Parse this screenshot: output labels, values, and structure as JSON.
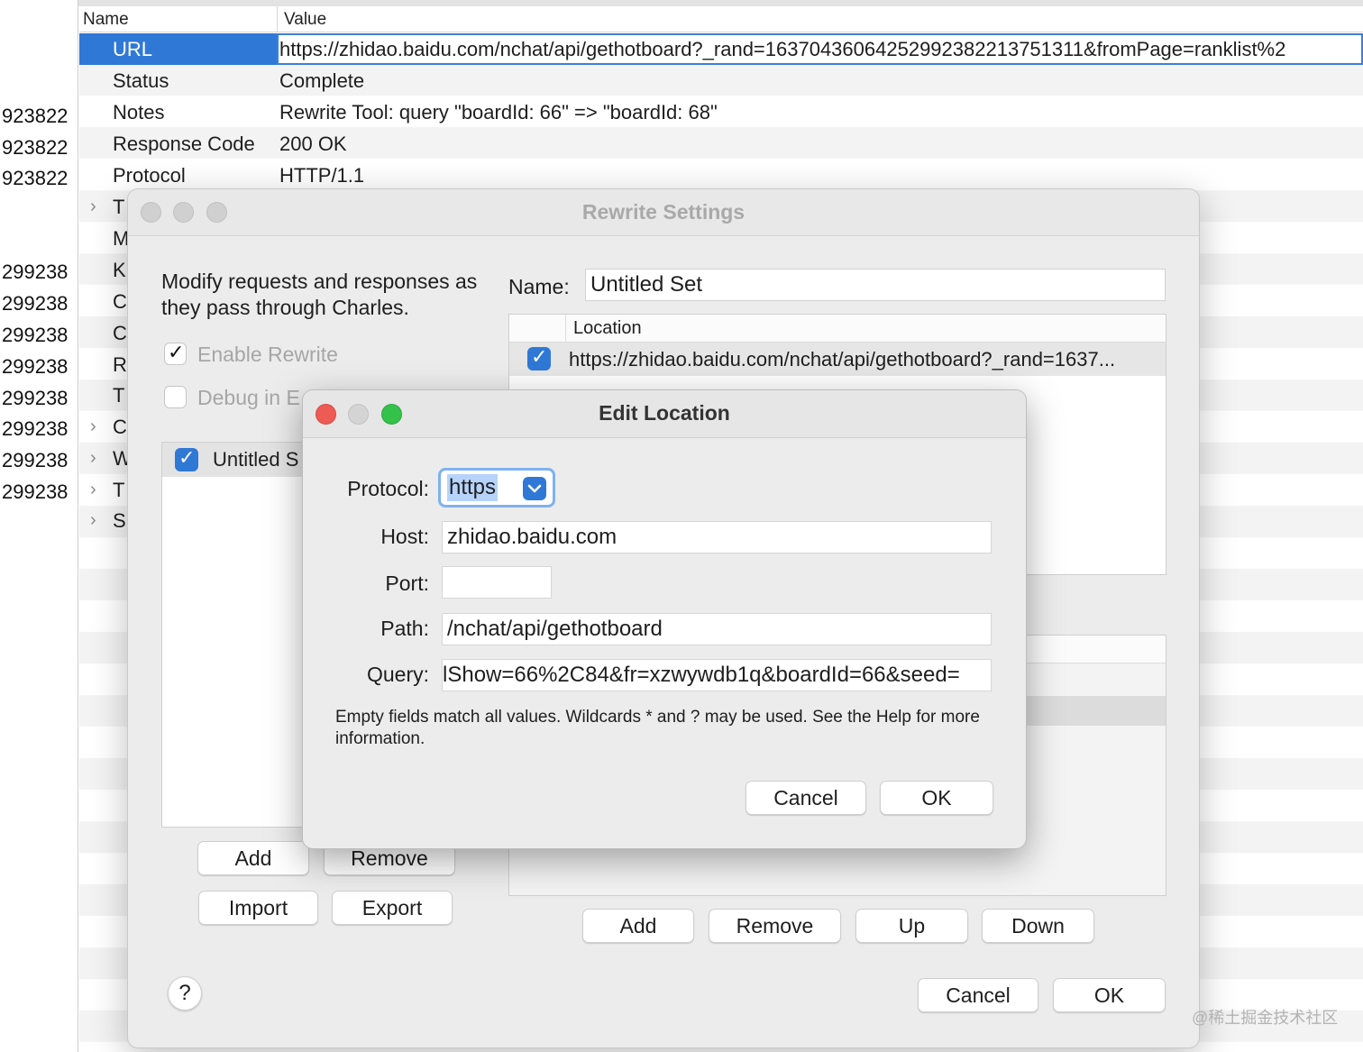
{
  "background": {
    "left_column_numbers": [
      "923822",
      "923822",
      "923822",
      "299238",
      "299238",
      "299238",
      "299238",
      "299238",
      "299238",
      "299238",
      "299238"
    ],
    "table": {
      "headers": {
        "name": "Name",
        "value": "Value"
      },
      "rows": [
        {
          "name": "URL",
          "value": "https://zhidao.baidu.com/nchat/api/gethotboard?_rand=16370436064252992382213751311&fromPage=ranklist%2"
        },
        {
          "name": "Status",
          "value": "Complete"
        },
        {
          "name": "Notes",
          "value": "Rewrite Tool: query \"boardId: 66\" => \"boardId: 68\""
        },
        {
          "name": "Response Code",
          "value": "200 OK"
        },
        {
          "name": "Protocol",
          "value": "HTTP/1.1"
        }
      ],
      "tree_items": [
        "T",
        "M",
        "K",
        "C",
        "C",
        "R",
        "T",
        "C",
        "W",
        "T",
        "S"
      ]
    }
  },
  "rewrite_settings": {
    "title": "Rewrite Settings",
    "description": "Modify requests and responses as they pass through Charles.",
    "enable_rewrite_label": "Enable Rewrite",
    "debug_label": "Debug in E",
    "sets": [
      {
        "label": "Untitled S",
        "checked": true
      }
    ],
    "name_label": "Name:",
    "name_value": "Untitled Set",
    "location_header": "Location",
    "locations": [
      {
        "value": "https://zhidao.baidu.com/nchat/api/gethotboard?_rand=1637...",
        "checked": true
      }
    ],
    "buttons": {
      "sets_add": "Add",
      "sets_remove": "Remove",
      "import": "Import",
      "export": "Export",
      "loc_add": "Add",
      "loc_remove": "Remove",
      "loc_up": "Up",
      "loc_down": "Down",
      "cancel": "Cancel",
      "ok": "OK",
      "help": "?"
    }
  },
  "edit_location": {
    "title": "Edit Location",
    "protocol_label": "Protocol:",
    "protocol_value": "https",
    "host_label": "Host:",
    "host_value": "zhidao.baidu.com",
    "port_label": "Port:",
    "port_value": "",
    "path_label": "Path:",
    "path_value": "/nchat/api/gethotboard",
    "query_label": "Query:",
    "query_value": "lShow=66%2C84&fr=xzwywdb1q&boardId=66&seed=",
    "hint": "Empty fields match all values. Wildcards * and ? may be used. See the Help for more information.",
    "cancel": "Cancel",
    "ok": "OK"
  },
  "watermark": "@稀土掘金技术社区",
  "colors": {
    "accent": "#2f78d6",
    "selection": "#b6d3fb",
    "close": "#ee5b55",
    "zoom": "#34c24a"
  }
}
